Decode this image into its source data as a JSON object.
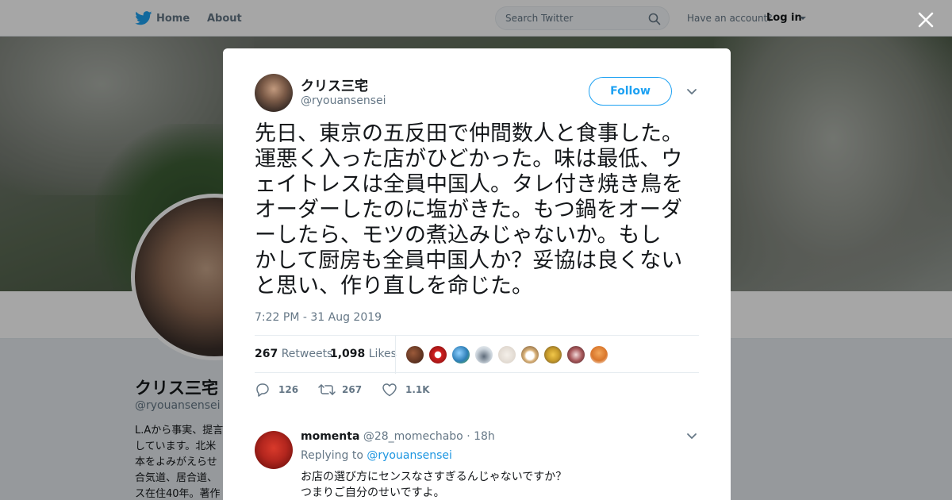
{
  "topbar": {
    "home_label": "Home",
    "about_label": "About",
    "search_placeholder": "Search Twitter",
    "account_prompt": "Have an account?",
    "login_label": "Log in"
  },
  "profile": {
    "name": "クリス三宅",
    "handle": "@ryouansensei",
    "bio_lines": [
      "L.Aから事実、提言",
      "しています。北米",
      "本をよみがえらせ",
      "合気道、居合道、",
      "ス在住40年。著作"
    ]
  },
  "tweet": {
    "author_name": "クリス三宅",
    "author_handle": "@ryouansensei",
    "follow_label": "Follow",
    "text_lines": [
      "先日、東京の五反田で仲間数人と食事した。",
      "運悪く入った店がひどかった。味は最低、ウ",
      "ェイトレスは全員中国人。タレ付き焼き鳥を",
      "オーダーしたのに塩がきた。もつ鍋をオーダ",
      "ーしたら、モツの煮込みじゃないか。もし",
      "かして厨房も全員中国人か？妥協は良くない",
      "と思い、作り直しを命じた。"
    ],
    "timestamp": "7:22 PM - 31 Aug 2019",
    "retweets_count": "267",
    "retweets_label": "Retweets",
    "likes_count": "1,098",
    "likes_label": "Likes",
    "actions": {
      "reply_count": "126",
      "retweet_count": "267",
      "like_count": "1.1K"
    }
  },
  "reply": {
    "name": "momenta",
    "handle": "@28_momechabo",
    "separator": "·",
    "time": "18h",
    "replying_to_label": "Replying to",
    "replying_to_handle": "@ryouansensei",
    "text_lines": [
      "お店の選び方にセンスなさすぎるんじゃないですか？",
      "つまりご自分のせいですよ。"
    ]
  },
  "colors": {
    "accent": "#1da1f2",
    "link": "#1b95e0",
    "text_primary": "#14171a",
    "text_secondary": "#657786"
  }
}
